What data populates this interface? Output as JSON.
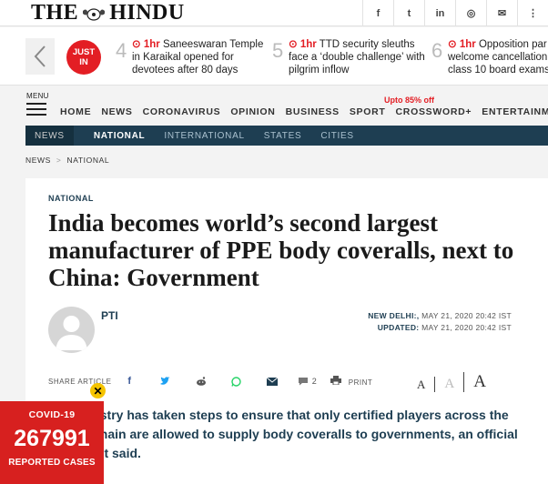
{
  "logo": {
    "left": "THE",
    "right": "HINDU"
  },
  "social": [
    {
      "icon": "facebook-icon",
      "glyph": "f"
    },
    {
      "icon": "twitter-icon",
      "glyph": "t"
    },
    {
      "icon": "linkedin-icon",
      "glyph": "in"
    },
    {
      "icon": "instagram-icon",
      "glyph": "◎"
    },
    {
      "icon": "mail-icon",
      "glyph": "✉"
    },
    {
      "icon": "more-icon",
      "glyph": "⋮"
    }
  ],
  "ticker": {
    "badge_line1": "JUST",
    "badge_line2": "IN",
    "items": [
      {
        "num": "4",
        "ago": "1hr",
        "text": "Saneeswaran Temple in Karaikal opened for devotees after 80 days"
      },
      {
        "num": "5",
        "ago": "1hr",
        "text": "TTD security sleuths face a ‘double challenge’ with pilgrim inflow"
      },
      {
        "num": "6",
        "ago": "1hr",
        "text": "Opposition par welcome cancellation class 10 board exams,"
      }
    ]
  },
  "menu_label": "MENU",
  "promo": "Upto 85% off",
  "nav": [
    "HOME",
    "NEWS",
    "CORONAVIRUS",
    "OPINION",
    "BUSINESS",
    "SPORT",
    "CROSSWORD+",
    "ENTERTAINMENT"
  ],
  "subnav": {
    "news": "NEWS",
    "items": [
      "NATIONAL",
      "INTERNATIONAL",
      "STATES",
      "CITIES"
    ]
  },
  "breadcrumb": [
    "NEWS",
    "NATIONAL"
  ],
  "article": {
    "section": "NATIONAL",
    "headline": "India becomes world’s second largest manufacturer of PPE body coveralls, next to China: Government",
    "author": "PTI",
    "dateline_place": "NEW DELHI:,",
    "dateline_date": "MAY 21, 2020 20:42 IST",
    "updated_label": "UPDATED:",
    "updated_date": "MAY 21, 2020 20:42 IST",
    "share_label": "SHARE ARTICLE",
    "comments": "2",
    "print_label": "PRINT",
    "font_sizes": [
      "A",
      "A",
      "A"
    ],
    "lead": "The Ministry has taken steps to ensure that only certified players across the supply chain are allowed to supply body coveralls to governments, an official statement said."
  },
  "covid": {
    "title": "COVID-19",
    "count": "267991",
    "footer": "REPORTED CASES"
  },
  "colors": {
    "brand_red": "#e31e24",
    "nav_blue": "#1e3e52",
    "covid_red": "#d7201f",
    "close_yellow": "#f5c400"
  }
}
